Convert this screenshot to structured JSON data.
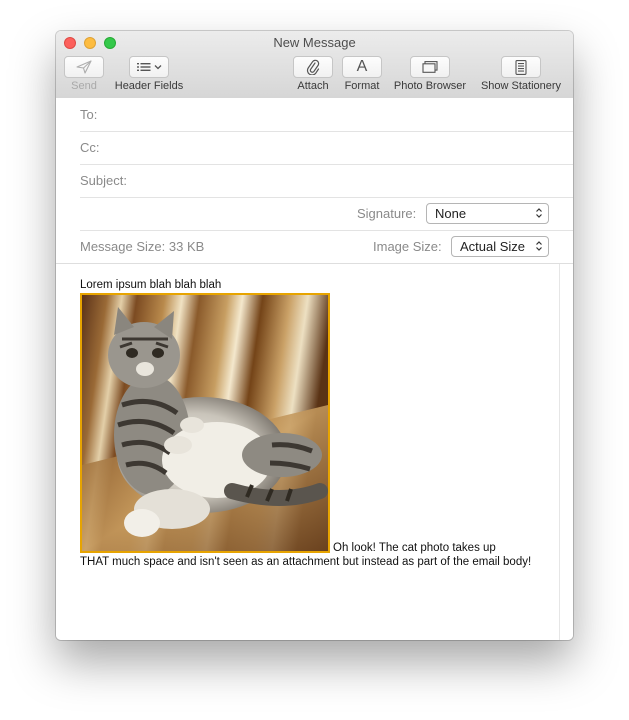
{
  "window": {
    "title": "New Message"
  },
  "toolbar": {
    "send_label": "Send",
    "header_fields_label": "Header Fields",
    "attach_label": "Attach",
    "format_label": "Format",
    "format_glyph": "A",
    "photo_browser_label": "Photo Browser",
    "show_stationery_label": "Show Stationery"
  },
  "headers": {
    "to_label": "To:",
    "to_value": "",
    "cc_label": "Cc:",
    "cc_value": "",
    "subject_label": "Subject:",
    "subject_value": "",
    "signature_label": "Signature:",
    "signature_value": "None",
    "message_size_label": "Message Size: 33 KB",
    "image_size_label": "Image Size:",
    "image_size_value": "Actual Size"
  },
  "body": {
    "intro_text": "Lorem ipsum blah blah blah",
    "caption_line1": "Oh look! The cat photo takes up",
    "caption_rest": "THAT much space and isn't seen as an attachment but instead as part of the email body!"
  },
  "colors": {
    "close": "#fc605c",
    "minimize": "#fdbc40",
    "maximize": "#34c84a",
    "image_selection_border": "#e7a400"
  },
  "icons": [
    "send-icon",
    "list-icon",
    "chevron-down-icon",
    "paperclip-icon",
    "format-icon",
    "photo-browser-icon",
    "stationery-icon",
    "updown-chevron-icon"
  ]
}
